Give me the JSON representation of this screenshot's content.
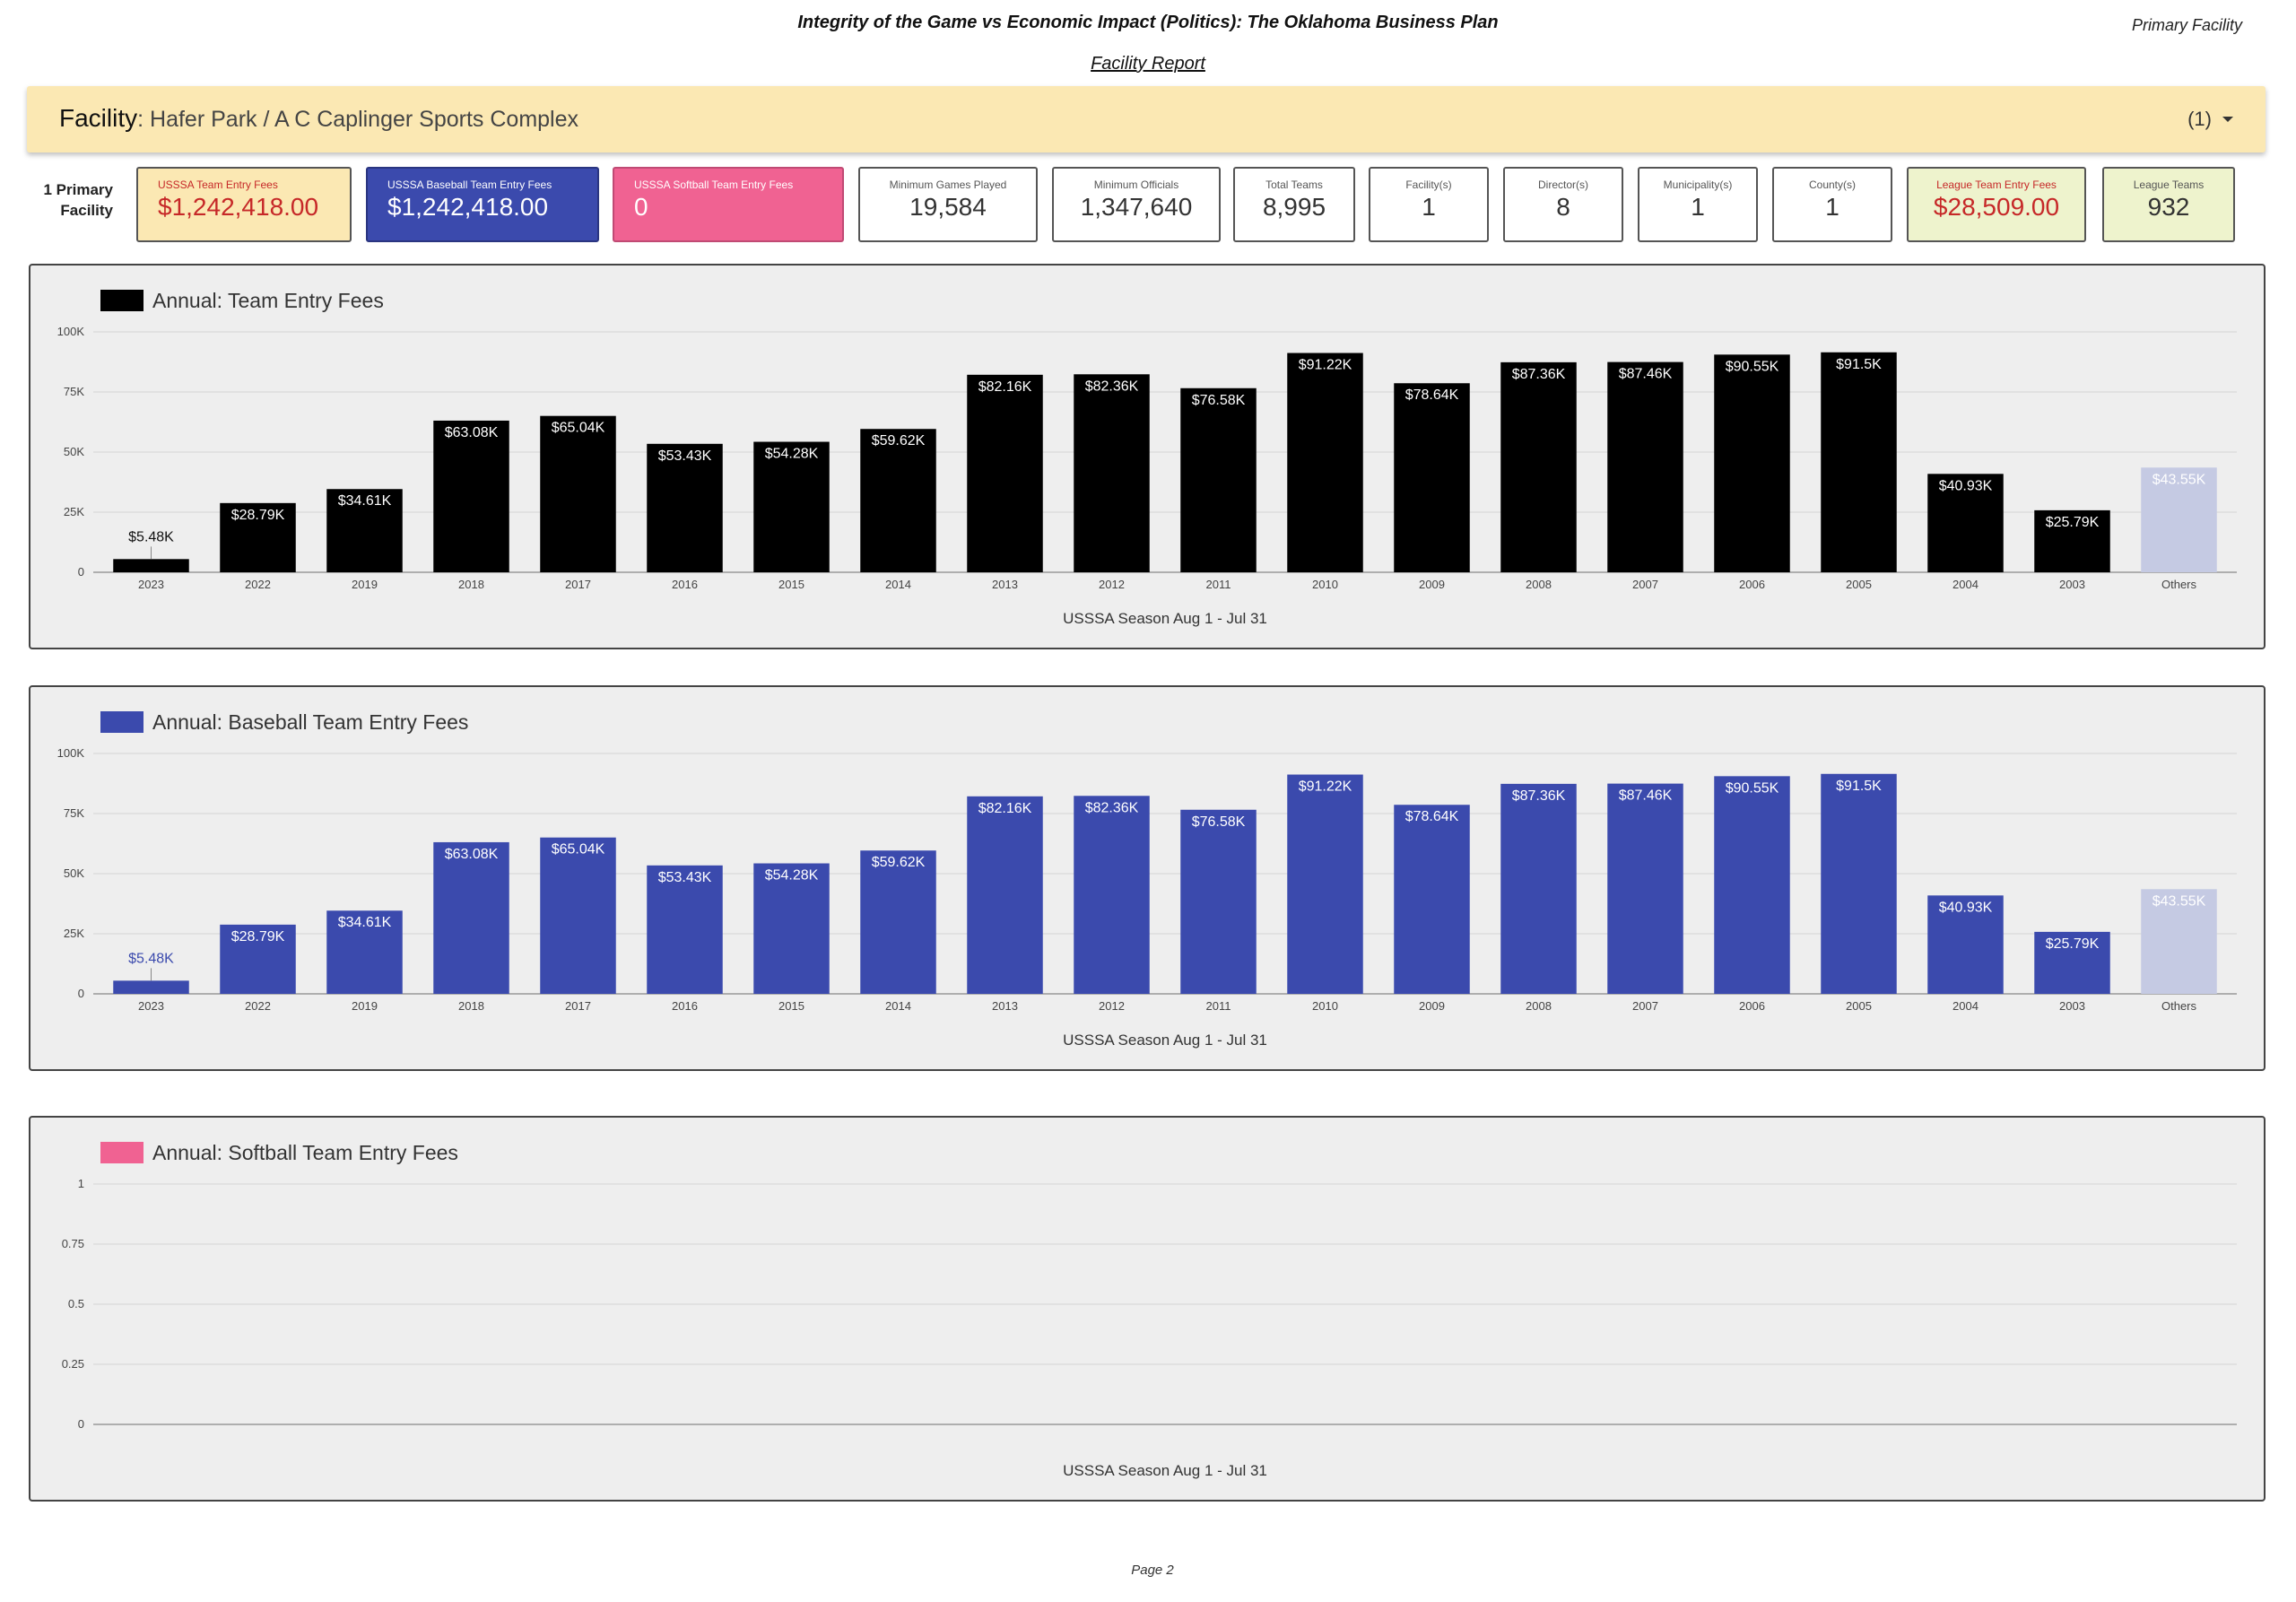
{
  "header": {
    "title": "Integrity of the Game vs Economic Impact (Politics): The Oklahoma Business Plan",
    "corner_label": "Primary Facility",
    "subtitle": "Facility Report"
  },
  "facility": {
    "label": "Facility",
    "value": "Hafer Park / A C Caplinger Sports Complex",
    "count": "(1)"
  },
  "kpi_group_label": "1 Primary Facility",
  "kpis": [
    {
      "title": "USSSA Team Entry Fees",
      "value": "$1,242,418.00"
    },
    {
      "title": "USSSA Baseball Team Entry Fees",
      "value": "$1,242,418.00"
    },
    {
      "title": "USSSA Softball Team Entry Fees",
      "value": "0"
    },
    {
      "title": "Minimum Games Played",
      "value": "19,584"
    },
    {
      "title": "Minimum Officials",
      "value": "1,347,640"
    },
    {
      "title": "Total Teams",
      "value": "8,995"
    },
    {
      "title": "Facility(s)",
      "value": "1"
    },
    {
      "title": "Director(s)",
      "value": "8"
    },
    {
      "title": "Municipality(s)",
      "value": "1"
    },
    {
      "title": "County(s)",
      "value": "1"
    },
    {
      "title": "League Team Entry Fees",
      "value": "$28,509.00"
    },
    {
      "title": "League Teams",
      "value": "932"
    }
  ],
  "colors": {
    "black_series": "#000000",
    "baseball_series": "#3b4aad",
    "softball_series": "#f06292",
    "others": "#c5cae3",
    "kpi_red_text": "#c62828",
    "yellow_card": "#fbe8b3",
    "green_card": "#eef3cd"
  },
  "chart_data": [
    {
      "type": "bar",
      "title": "Annual: Team Entry Fees",
      "xlabel": "USSSA Season Aug 1 - Jul 31",
      "categories": [
        "2023",
        "2022",
        "2019",
        "2018",
        "2017",
        "2016",
        "2015",
        "2014",
        "2013",
        "2012",
        "2011",
        "2010",
        "2009",
        "2008",
        "2007",
        "2006",
        "2005",
        "2004",
        "2003",
        "Others"
      ],
      "values": [
        5480,
        28790,
        34610,
        63080,
        65040,
        53430,
        54280,
        59620,
        82160,
        82360,
        76580,
        91220,
        78640,
        87360,
        87460,
        90550,
        91500,
        40930,
        25790,
        43550
      ],
      "data_labels": [
        "$5.48K",
        "$28.79K",
        "$34.61K",
        "$63.08K",
        "$65.04K",
        "$53.43K",
        "$54.28K",
        "$59.62K",
        "$82.16K",
        "$82.36K",
        "$76.58K",
        "$91.22K",
        "$78.64K",
        "$87.36K",
        "$87.46K",
        "$90.55K",
        "$91.5K",
        "$40.93K",
        "$25.79K",
        "$43.55K"
      ],
      "ylim": [
        0,
        100000
      ],
      "yticks": [
        "0",
        "25K",
        "50K",
        "75K",
        "100K"
      ],
      "color": "#000000",
      "grid": true
    },
    {
      "type": "bar",
      "title": "Annual: Baseball Team Entry Fees",
      "xlabel": "USSSA Season Aug 1 - Jul 31",
      "categories": [
        "2023",
        "2022",
        "2019",
        "2018",
        "2017",
        "2016",
        "2015",
        "2014",
        "2013",
        "2012",
        "2011",
        "2010",
        "2009",
        "2008",
        "2007",
        "2006",
        "2005",
        "2004",
        "2003",
        "Others"
      ],
      "values": [
        5480,
        28790,
        34610,
        63080,
        65040,
        53430,
        54280,
        59620,
        82160,
        82360,
        76580,
        91220,
        78640,
        87360,
        87460,
        90550,
        91500,
        40930,
        25790,
        43550
      ],
      "data_labels": [
        "$5.48K",
        "$28.79K",
        "$34.61K",
        "$63.08K",
        "$65.04K",
        "$53.43K",
        "$54.28K",
        "$59.62K",
        "$82.16K",
        "$82.36K",
        "$76.58K",
        "$91.22K",
        "$78.64K",
        "$87.36K",
        "$87.46K",
        "$90.55K",
        "$91.5K",
        "$40.93K",
        "$25.79K",
        "$43.55K"
      ],
      "ylim": [
        0,
        100000
      ],
      "yticks": [
        "0",
        "25K",
        "50K",
        "75K",
        "100K"
      ],
      "color": "#3b4aad",
      "grid": true
    },
    {
      "type": "bar",
      "title": "Annual: Softball Team Entry Fees",
      "xlabel": "USSSA Season Aug 1 - Jul 31",
      "categories": [],
      "values": [],
      "data_labels": [],
      "ylim": [
        0,
        1
      ],
      "yticks": [
        "0",
        "0.25",
        "0.5",
        "0.75",
        "1"
      ],
      "color": "#f06292",
      "grid": true
    }
  ],
  "footer": {
    "page": "Page 2"
  }
}
